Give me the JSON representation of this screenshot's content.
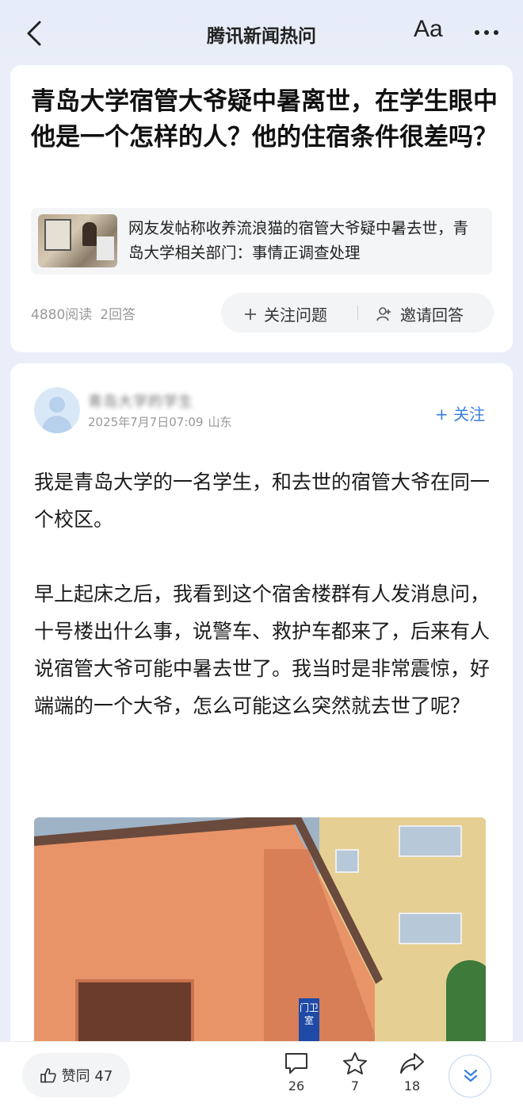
{
  "header": {
    "title": "腾讯新闻热问",
    "font_label": "Aa"
  },
  "question": {
    "title": "青岛大学宿管大爷疑中暑离世，在学生眼中他是一个怎样的人？他的住宿条件很差吗？",
    "related_news": "网友发帖称收养流浪猫的宿管大爷疑中暑去世，青岛大学相关部门：事情正调查处理",
    "reads": "4880阅读",
    "answers": "2回答",
    "follow_label": "关注问题",
    "invite_label": "邀请回答"
  },
  "answer": {
    "author": "青岛大学的学生",
    "date": "2025年7月7日07:09",
    "location": "山东",
    "follow_label": "+ 关注",
    "paragraphs": [
      "我是青岛大学的一名学生，和去世的宿管大爷在同一个校区。",
      "早上起床之后，我看到这个宿舍楼群有人发消息问，十号楼出什么事，说警车、救护车都来了，后来有人说宿管大爷可能中暑去世了。我当时是非常震惊，好端端的一个大爷，怎么可能这么突然就去世了呢？"
    ],
    "photo_sign": "门卫室"
  },
  "bottom": {
    "agree_label": "赞同 47",
    "comments": "26",
    "favorites": "7",
    "shares": "18"
  },
  "colors": {
    "accent": "#3b7fe0",
    "background": "#e9eef8"
  }
}
